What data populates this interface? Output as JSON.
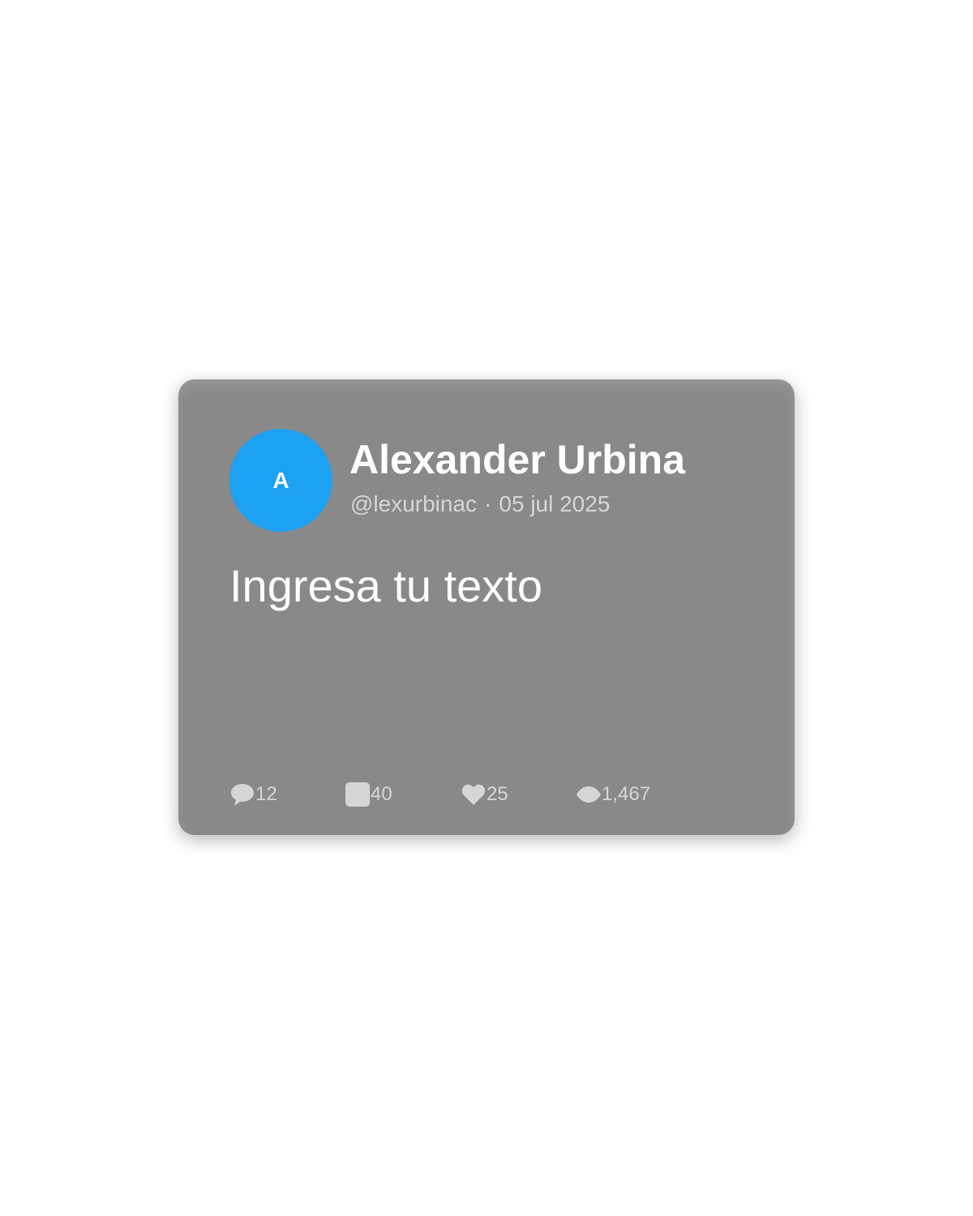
{
  "post": {
    "avatar_initial": "A",
    "author_name": "Alexander Urbina",
    "handle": "@lexurbinac",
    "separator": "·",
    "date": "05 jul 2025",
    "text": "Ingresa tu texto"
  },
  "stats": {
    "replies": {
      "icon": "comment-icon",
      "count": "12"
    },
    "reposts": {
      "icon": "repost-icon",
      "count": "40"
    },
    "likes": {
      "icon": "heart-icon",
      "count": "25"
    },
    "views": {
      "icon": "eye-icon",
      "count": "1,467"
    }
  },
  "colors": {
    "card_background": "#898989",
    "avatar": "#1da1f2",
    "primary_text": "#ffffff",
    "secondary_text": "#d6d6d6",
    "page_background": "#ffffff"
  }
}
